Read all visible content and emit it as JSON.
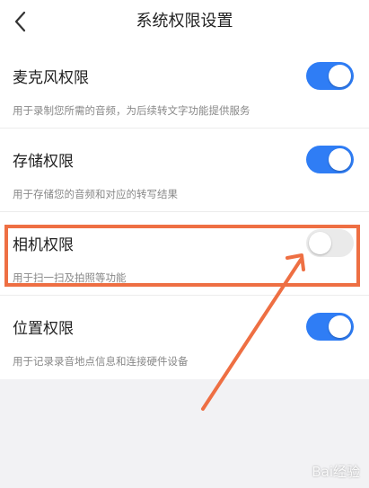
{
  "header": {
    "title": "系统权限设置",
    "back_icon": "chevron-left-icon"
  },
  "permissions": [
    {
      "title": "麦克风权限",
      "description": "用于录制您所需的音频，为后续转文字功能提供服务",
      "enabled": true
    },
    {
      "title": "存储权限",
      "description": "用于存储您的音频和对应的转写结果",
      "enabled": true
    },
    {
      "title": "相机权限",
      "description": "用于扫一扫及拍照等功能",
      "enabled": false
    },
    {
      "title": "位置权限",
      "description": "用于记录录音地点信息和连接硬件设备",
      "enabled": true
    }
  ],
  "colors": {
    "toggle_on": "#2f7df5",
    "toggle_off": "#eaeaea",
    "annotation": "#ee6f43",
    "page_bg": "#f2f2f4"
  },
  "watermark": "Bai经验"
}
